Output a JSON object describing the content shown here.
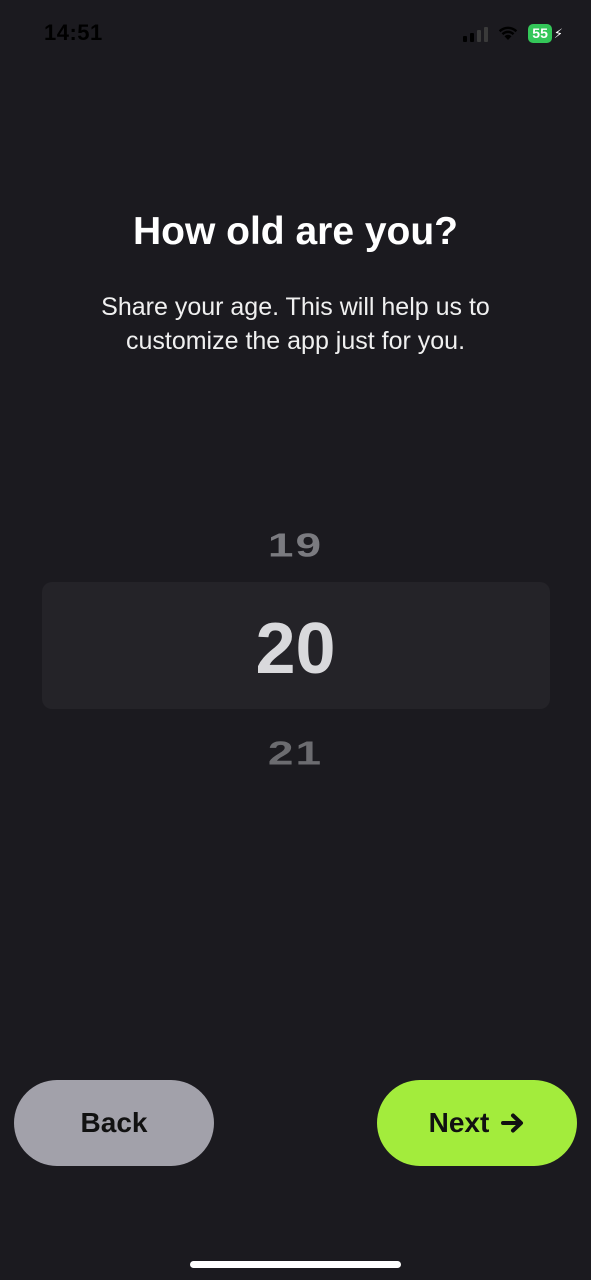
{
  "status_bar": {
    "time": "14:51",
    "battery_level": "55",
    "icons": [
      "signal-icon",
      "wifi-icon",
      "battery-icon",
      "charging-bolt-icon"
    ]
  },
  "question": {
    "title": "How old are you?",
    "subtitle": "Share your age. This will help us to customize the app just for you."
  },
  "age_picker": {
    "previous": "19",
    "selected": "20",
    "next": "21"
  },
  "buttons": {
    "back_label": "Back",
    "next_label": "Next",
    "next_icon": "arrow-right-icon"
  },
  "colors": {
    "background": "#1b1a1f",
    "accent": "#a3ec3c",
    "back_button": "#a2a1aa",
    "battery": "#34c759"
  }
}
